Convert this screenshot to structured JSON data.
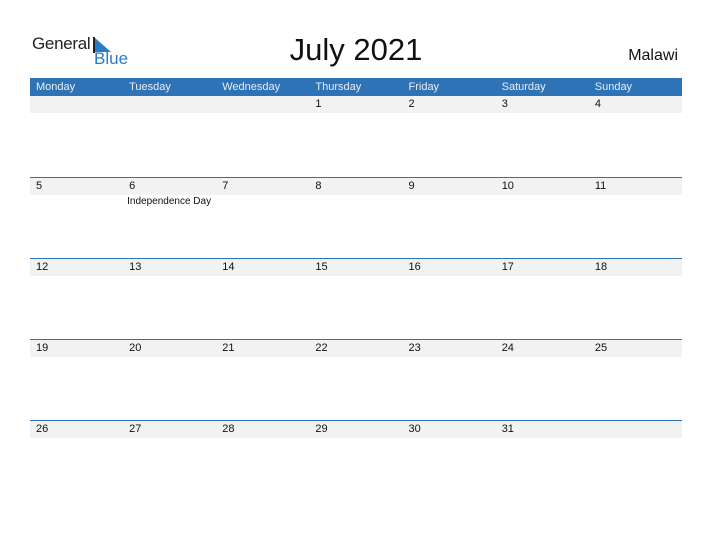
{
  "logo": {
    "word1": "General",
    "word2": "Blue"
  },
  "title": "July 2021",
  "country": "Malawi",
  "colors": {
    "accent": "#2e73b5",
    "date_strip": "#f2f2f2",
    "logo_blue": "#2a7ac6"
  },
  "weekdays": [
    "Monday",
    "Tuesday",
    "Wednesday",
    "Thursday",
    "Friday",
    "Saturday",
    "Sunday"
  ],
  "weeks": [
    {
      "days": [
        {
          "num": ""
        },
        {
          "num": ""
        },
        {
          "num": ""
        },
        {
          "num": "1"
        },
        {
          "num": "2"
        },
        {
          "num": "3"
        },
        {
          "num": "4"
        }
      ]
    },
    {
      "days": [
        {
          "num": "5"
        },
        {
          "num": "6",
          "event": "Independence Day"
        },
        {
          "num": "7"
        },
        {
          "num": "8"
        },
        {
          "num": "9"
        },
        {
          "num": "10"
        },
        {
          "num": "11"
        }
      ]
    },
    {
      "days": [
        {
          "num": "12"
        },
        {
          "num": "13"
        },
        {
          "num": "14"
        },
        {
          "num": "15"
        },
        {
          "num": "16"
        },
        {
          "num": "17"
        },
        {
          "num": "18"
        }
      ]
    },
    {
      "days": [
        {
          "num": "19"
        },
        {
          "num": "20"
        },
        {
          "num": "21"
        },
        {
          "num": "22"
        },
        {
          "num": "23"
        },
        {
          "num": "24"
        },
        {
          "num": "25"
        }
      ]
    },
    {
      "days": [
        {
          "num": "26"
        },
        {
          "num": "27"
        },
        {
          "num": "28"
        },
        {
          "num": "29"
        },
        {
          "num": "30"
        },
        {
          "num": "31"
        },
        {
          "num": ""
        }
      ]
    }
  ]
}
